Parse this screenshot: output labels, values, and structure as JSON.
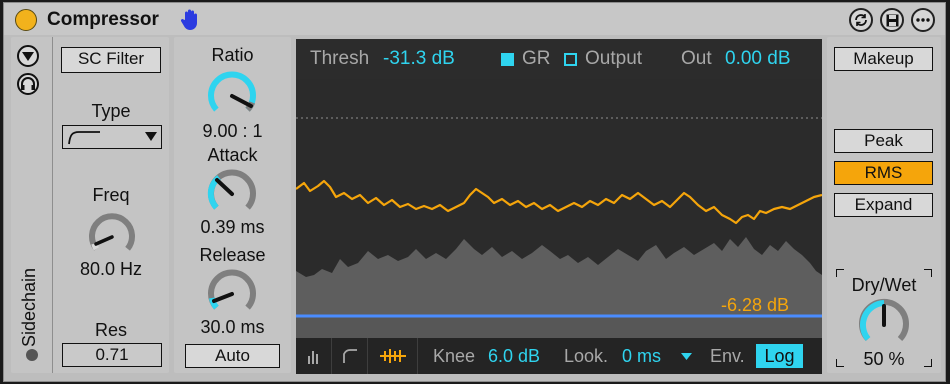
{
  "device": {
    "title": "Compressor",
    "icons": [
      "hand-icon",
      "sync-icon",
      "save-icon",
      "more-icon"
    ]
  },
  "sidechain": {
    "label": "Sidechain",
    "sc_filter": "SC Filter",
    "type_label": "Type",
    "freq_label": "Freq",
    "freq_value": "80.0 Hz",
    "res_label": "Res",
    "res_value": "0.71"
  },
  "knobs": {
    "ratio_label": "Ratio",
    "ratio_value": "9.00 : 1",
    "attack_label": "Attack",
    "attack_value": "0.39 ms",
    "release_label": "Release",
    "release_value": "30.0 ms",
    "auto": "Auto"
  },
  "display": {
    "thresh_label": "Thresh",
    "thresh_value": "-31.3 dB",
    "gr_label": "GR",
    "output_label": "Output",
    "out_label": "Out",
    "out_value": "0.00 dB",
    "gr_readout": "-6.28 dB",
    "knee_label": "Knee",
    "knee_value": "6.0 dB",
    "look_label": "Look.",
    "look_value": "0 ms",
    "env_label": "Env.",
    "env_value": "Log"
  },
  "right": {
    "makeup": "Makeup",
    "peak": "Peak",
    "rms": "RMS",
    "expand": "Expand",
    "drywet_label": "Dry/Wet",
    "drywet_value": "50 %",
    "active_mode": "RMS"
  },
  "colors": {
    "accent_orange": "#f5a50b",
    "accent_cyan": "#2fd4ef",
    "power": "#f2b21c",
    "threshold_line": "#4a8cff"
  }
}
